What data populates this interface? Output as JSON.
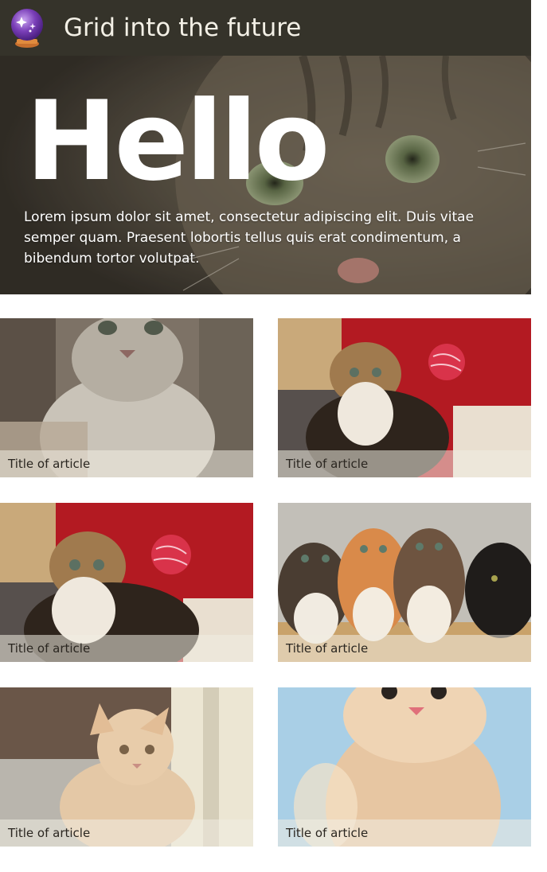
{
  "header": {
    "title": "Grid into the future",
    "logo_icon": "crystal-ball-icon"
  },
  "hero": {
    "heading": "Hello",
    "text": "Lorem ipsum dolor sit amet, consectetur adipiscing elit. Duis vitae semper quam. Praesent lobortis tellus quis erat condimentum, a bibendum tortor volutpat."
  },
  "articles": [
    {
      "title": "Title of article"
    },
    {
      "title": "Title of article"
    },
    {
      "title": "Title of article"
    },
    {
      "title": "Title of article"
    },
    {
      "title": "Title of article"
    },
    {
      "title": "Title of article"
    }
  ],
  "colors": {
    "header_bg": "#35332a",
    "header_text": "#f3f0e6",
    "caption_overlay": "#f0ece2"
  }
}
